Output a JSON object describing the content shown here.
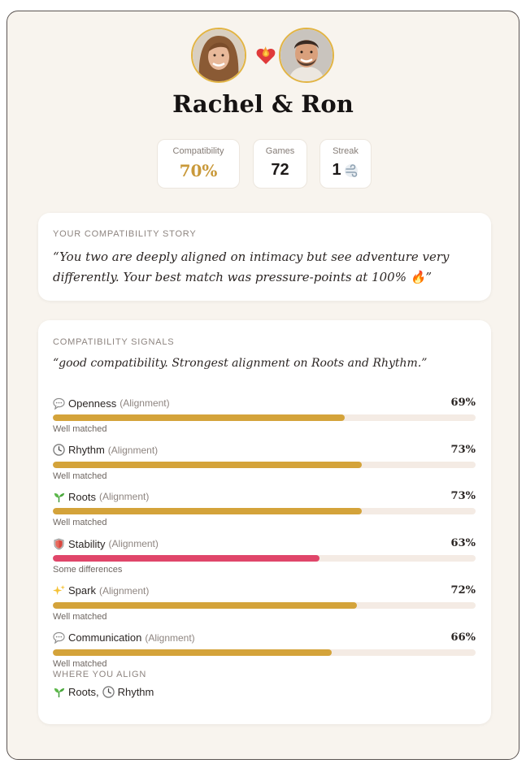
{
  "header": {
    "title": "Rachel & Ron",
    "avatars": [
      {
        "name": "Rachel",
        "icon": "avatar-woman"
      },
      {
        "name": "Ron",
        "icon": "avatar-man"
      }
    ],
    "heart_icon": "fiery-heart-icon"
  },
  "stats": {
    "compatibility": {
      "label": "Compatibility",
      "value": "70%"
    },
    "games": {
      "label": "Games",
      "value": "72"
    },
    "streak": {
      "label": "Streak",
      "value": "1",
      "icon": "wind-icon"
    }
  },
  "story": {
    "heading": "YOUR COMPATIBILITY STORY",
    "quote": "“You two are deeply aligned on intimacy but see adventure very differently. Your best match was pressure-points at 100% 🔥”"
  },
  "signals": {
    "heading": "COMPATIBILITY SIGNALS",
    "summary": "“good compatibility. Strongest alignment on Roots and Rhythm.”",
    "items": [
      {
        "name": "Openness",
        "type": "(Alignment)",
        "percent": 69,
        "percent_label": "69%",
        "note": "Well matched",
        "icon": "speech-bubble-icon",
        "color": "#d4a33a"
      },
      {
        "name": "Rhythm",
        "type": "(Alignment)",
        "percent": 73,
        "percent_label": "73%",
        "note": "Well matched",
        "icon": "clock-icon",
        "color": "#d4a33a"
      },
      {
        "name": "Roots",
        "type": "(Alignment)",
        "percent": 73,
        "percent_label": "73%",
        "note": "Well matched",
        "icon": "seedling-icon",
        "color": "#d4a33a"
      },
      {
        "name": "Stability",
        "type": "(Alignment)",
        "percent": 63,
        "percent_label": "63%",
        "note": "Some differences",
        "icon": "shield-icon",
        "color": "#e0466a"
      },
      {
        "name": "Spark",
        "type": "(Alignment)",
        "percent": 72,
        "percent_label": "72%",
        "note": "Well matched",
        "icon": "sparkles-icon",
        "color": "#d4a33a"
      },
      {
        "name": "Communication",
        "type": "(Alignment)",
        "percent": 66,
        "percent_label": "66%",
        "note": "Well matched",
        "icon": "speech-bubble-icon",
        "color": "#d4a33a"
      }
    ],
    "align_heading": "WHERE YOU ALIGN",
    "align_items": [
      {
        "label": "Roots,",
        "icon": "seedling-icon"
      },
      {
        "label": "Rhythm",
        "icon": "clock-icon"
      }
    ]
  }
}
